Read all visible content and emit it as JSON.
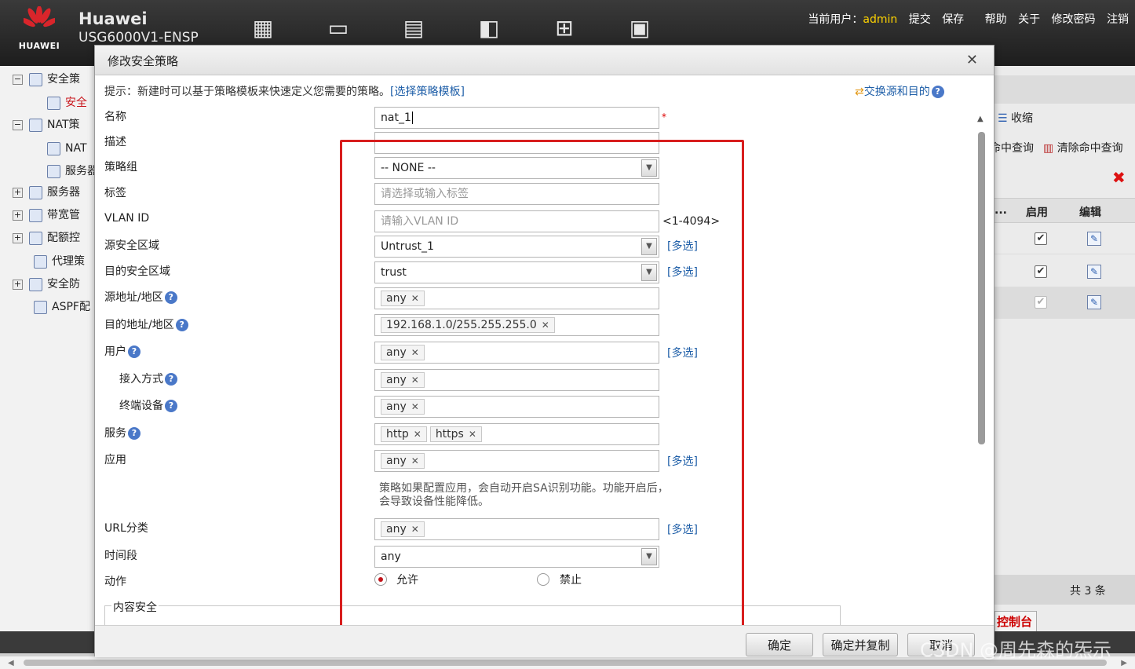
{
  "header": {
    "brand": "Huawei",
    "model": "USG6000V1-ENSP",
    "logo_text": "HUAWEI",
    "user_label": "当前用户：",
    "user_name": "admin",
    "actions": [
      "提交",
      "保存",
      "帮助",
      "关于",
      "修改密码",
      "注销"
    ],
    "nav_icons": [
      "dashboard-icon",
      "monitor-icon",
      "policy-icon",
      "object-icon",
      "network-icon",
      "system-icon"
    ]
  },
  "tree": {
    "items": [
      {
        "label": "安全策",
        "expand": "−"
      },
      {
        "label": "安全",
        "active": true
      },
      {
        "label": "NAT策",
        "expand": "−"
      },
      {
        "label": "NAT"
      },
      {
        "label": "服务器"
      },
      {
        "label": "服务器",
        "expand": "+"
      },
      {
        "label": "带宽管",
        "expand": "+"
      },
      {
        "label": "配额控",
        "expand": "+"
      },
      {
        "label": "代理策"
      },
      {
        "label": "安全防",
        "expand": "+"
      },
      {
        "label": "ASPF配"
      }
    ]
  },
  "right_panel": {
    "collapse": "收缩",
    "hit_query": "命中查询",
    "clear_hit_query": "清除命中查询",
    "col_truncated": "...",
    "col_enable": "启用",
    "col_edit": "编辑",
    "total": "共 3 条",
    "console_tab": "控制台"
  },
  "dialog": {
    "title": "修改安全策略",
    "hint_text": "提示：新建时可以基于策略模板来快速定义您需要的策略。",
    "hint_link": "[选择策略模板]",
    "swap_link": "交换源和目的",
    "multi_select": "[多选]",
    "fields": {
      "name": {
        "label": "名称",
        "value": "nat_1",
        "required": "*"
      },
      "description": {
        "label": "描述",
        "value": ""
      },
      "policy_group": {
        "label": "策略组",
        "value": "-- NONE --"
      },
      "tag": {
        "label": "标签",
        "placeholder": "请选择或输入标签"
      },
      "vlan_id": {
        "label": "VLAN ID",
        "placeholder": "请输入VLAN ID",
        "range": "<1-4094>"
      },
      "source_zone": {
        "label": "源安全区域",
        "value": "Untrust_1"
      },
      "dest_zone": {
        "label": "目的安全区域",
        "value": "trust"
      },
      "source_address": {
        "label": "源地址/地区",
        "tags": [
          "any"
        ]
      },
      "dest_address": {
        "label": "目的地址/地区",
        "tags": [
          "192.168.1.0/255.255.255.0"
        ]
      },
      "user": {
        "label": "用户",
        "tags": [
          "any"
        ]
      },
      "access_mode": {
        "label": "接入方式",
        "tags": [
          "any"
        ]
      },
      "terminal_device": {
        "label": "终端设备",
        "tags": [
          "any"
        ]
      },
      "service": {
        "label": "服务",
        "tags": [
          "http",
          "https"
        ]
      },
      "application": {
        "label": "应用",
        "tags": [
          "any"
        ]
      },
      "url_category": {
        "label": "URL分类",
        "tags": [
          "any"
        ]
      },
      "time_range": {
        "label": "时间段",
        "value": "any"
      },
      "action": {
        "label": "动作",
        "options": [
          "允许",
          "禁止"
        ],
        "selected": "允许"
      }
    },
    "app_note": "策略如果配置应用，会自动开启SA识别功能。功能开启后，会导致设备性能降低。",
    "content_security_legend": "内容安全",
    "buttons": {
      "ok": "确定",
      "ok_copy": "确定并复制",
      "cancel": "取消"
    }
  },
  "watermark": "CSDN @周先森的炁示",
  "colors": {
    "highlight_box": "#d81e1e",
    "link": "#1f5fa8",
    "user_name": "#ffd400",
    "radio_selected": "#c2141b"
  }
}
